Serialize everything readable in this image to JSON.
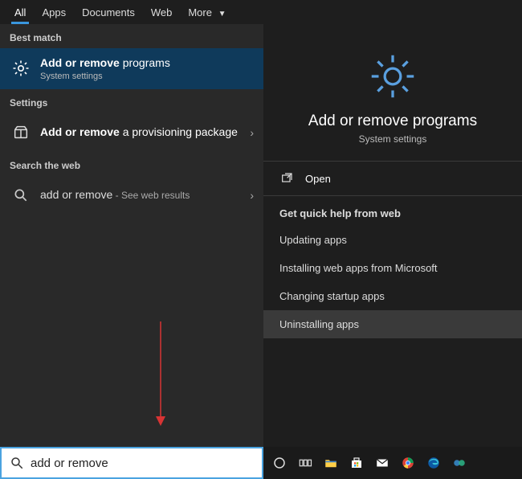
{
  "tabs": {
    "all": "All",
    "apps": "Apps",
    "documents": "Documents",
    "web": "Web",
    "more": "More"
  },
  "left": {
    "best_match_label": "Best match",
    "result1_bold": "Add or remove",
    "result1_rest": " programs",
    "result1_sub": "System settings",
    "settings_label": "Settings",
    "result2_bold": "Add or remove",
    "result2_rest": " a provisioning package",
    "search_web_label": "Search the web",
    "web_bold": "add or remove",
    "web_suffix": " - See web results"
  },
  "right": {
    "headline": "Add or remove programs",
    "sub": "System settings",
    "open": "Open",
    "help_header": "Get quick help from web",
    "help": {
      "updating": "Updating apps",
      "installing": "Installing web apps from Microsoft",
      "startup": "Changing startup apps",
      "uninstalling": "Uninstalling apps"
    }
  },
  "search": {
    "value": "add or remove"
  }
}
